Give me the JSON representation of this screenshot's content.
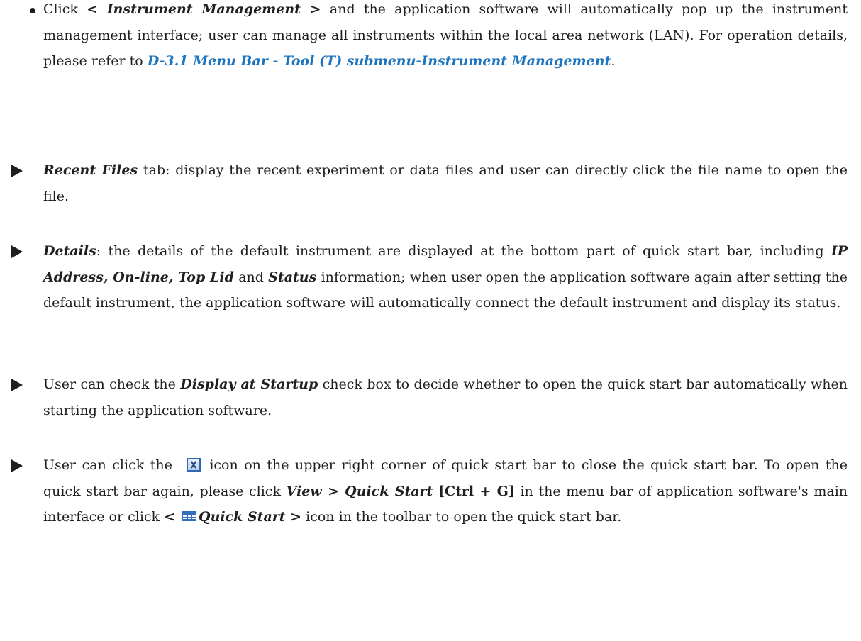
{
  "items": [
    {
      "marker": "dot",
      "segments": [
        {
          "t": "Click "
        },
        {
          "t": "< Instrument Management >",
          "s": "bi"
        },
        {
          "t": " and the application software will automatically pop up the instrument management interface; user can manage all instruments within the local area network (LAN). For operation details, please refer to "
        },
        {
          "t": "D-3.1 Menu Bar - Tool (T) submenu-Instrument Management",
          "s": "link"
        },
        {
          "t": "."
        }
      ]
    },
    {
      "marker": "triangle",
      "segments": [
        {
          "t": "Recent Files",
          "s": "bi"
        },
        {
          "t": " tab: display the recent experiment or data files and user can directly click the file name to open the file."
        }
      ]
    },
    {
      "marker": "triangle",
      "segments": [
        {
          "t": "Details",
          "s": "bi"
        },
        {
          "t": ": the details of the default instrument are displayed at the bottom part of quick start bar, including "
        },
        {
          "t": "IP Address, On-line, Top Lid",
          "s": "bi"
        },
        {
          "t": " and "
        },
        {
          "t": "Status",
          "s": "bi"
        },
        {
          "t": " information; when user open the application software again after setting the default instrument, the application software will automatically connect the default instrument and display its status."
        }
      ]
    },
    {
      "marker": "triangle",
      "segments": [
        {
          "t": "User can check the "
        },
        {
          "t": "Display at Startup",
          "s": "bi"
        },
        {
          "t": " check box to decide whether to open the quick start bar automatically when starting the application software."
        }
      ]
    },
    {
      "marker": "triangle",
      "segments": [
        {
          "t": "User can click the "
        },
        {
          "icon": "close-box-icon"
        },
        {
          "t": "icon on the upper right corner of quick start bar to close the quick start bar. To open the quick start bar again, please click "
        },
        {
          "t": "View > Quick Start",
          "s": "bi"
        },
        {
          "t": " "
        },
        {
          "t": "[Ctrl + G]",
          "s": "nb"
        },
        {
          "t": " in the menu bar of application software's main interface or click "
        },
        {
          "t": "<",
          "s": "nb"
        },
        {
          "icon": "grid-table-icon"
        },
        {
          "t": "Quick Start >",
          "s": "bi"
        },
        {
          "t": " icon in the toolbar to open the quick start bar."
        }
      ]
    }
  ],
  "colors": {
    "text": "#1f1f1f",
    "link": "#1f74be",
    "icon": "#2f68b4"
  }
}
